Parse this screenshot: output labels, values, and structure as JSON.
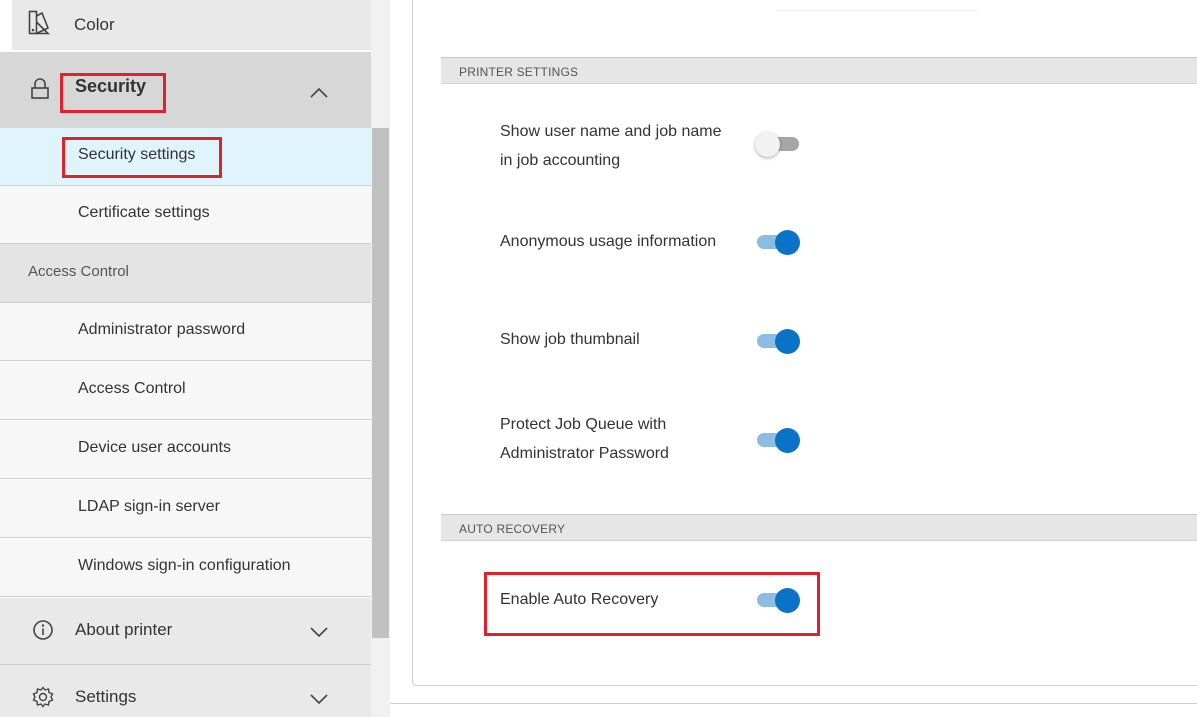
{
  "sidebar": {
    "color_label": "Color",
    "security_label": "Security",
    "items": [
      {
        "label": "Security settings"
      },
      {
        "label": "Certificate settings"
      }
    ],
    "group_label": "Access Control",
    "group_items": [
      {
        "label": "Administrator password"
      },
      {
        "label": "Access Control"
      },
      {
        "label": "Device user accounts"
      },
      {
        "label": "LDAP sign-in server"
      },
      {
        "label": "Windows sign-in configuration"
      }
    ],
    "about_label": "About printer",
    "settings_label": "Settings"
  },
  "main": {
    "printer_settings_header": "PRINTER SETTINGS",
    "settings": [
      {
        "label_line1": "Show user name and job name",
        "label_line2": "in job accounting",
        "enabled": false
      },
      {
        "label_line1": "Anonymous usage information",
        "enabled": true
      },
      {
        "label_line1": "Show job thumbnail",
        "enabled": true
      },
      {
        "label_line1": "Protect Job Queue with",
        "label_line2": "Administrator Password",
        "enabled": true
      }
    ],
    "auto_recovery_header": "AUTO RECOVERY",
    "auto_recovery": {
      "label": "Enable Auto Recovery",
      "enabled": true
    }
  },
  "colors": {
    "accent": "#0a72c7",
    "highlight_box": "#e0202c",
    "active_item_bg": "#dff4fb"
  },
  "icons": [
    "color-palette-icon",
    "lock-icon",
    "chevron-up-icon",
    "info-icon",
    "chevron-down-icon",
    "gear-icon"
  ]
}
